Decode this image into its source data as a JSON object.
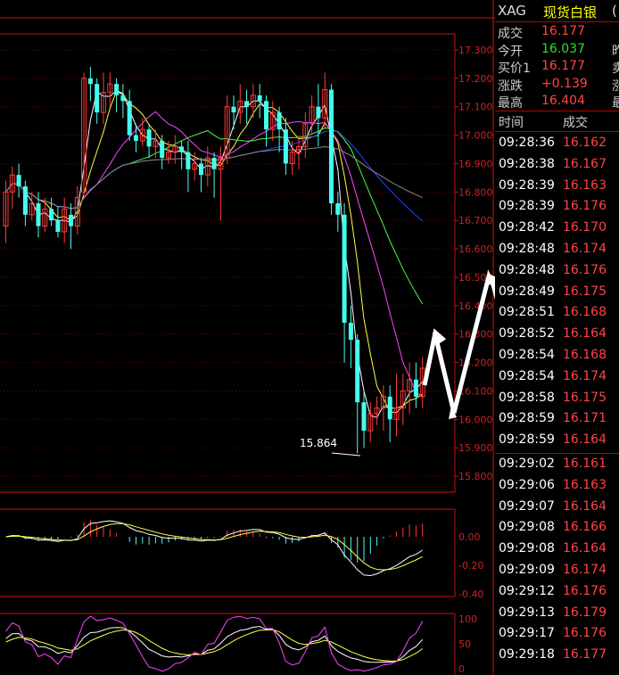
{
  "chart_data": {
    "type": "candlestick",
    "price_axis": {
      "ticks": [
        "17.300",
        "17.200",
        "17.100",
        "17.000",
        "16.900",
        "16.800",
        "16.700",
        "16.600",
        "16.500",
        "16.400",
        "16.300",
        "16.200",
        "16.100",
        "16.000",
        "15.900",
        "15.800"
      ],
      "min": 15.75,
      "max": 17.35
    },
    "low_label": "15.864",
    "candles": [
      [
        16.68,
        16.8,
        16.62,
        16.84
      ],
      [
        16.8,
        16.86,
        16.74,
        16.89
      ],
      [
        16.86,
        16.82,
        16.78,
        16.9
      ],
      [
        16.82,
        16.72,
        16.68,
        16.84
      ],
      [
        16.72,
        16.76,
        16.7,
        16.8
      ],
      [
        16.76,
        16.68,
        16.64,
        16.8
      ],
      [
        16.68,
        16.74,
        16.66,
        16.78
      ],
      [
        16.74,
        16.7,
        16.68,
        16.78
      ],
      [
        16.7,
        16.66,
        16.64,
        16.75
      ],
      [
        16.66,
        16.74,
        16.62,
        16.78
      ],
      [
        16.72,
        16.68,
        16.6,
        16.76
      ],
      [
        16.68,
        16.78,
        16.65,
        16.82
      ],
      [
        16.8,
        17.2,
        16.78,
        17.22
      ],
      [
        17.2,
        17.18,
        17.12,
        17.24
      ],
      [
        17.18,
        17.08,
        17.04,
        17.2
      ],
      [
        17.08,
        17.15,
        17.04,
        17.22
      ],
      [
        17.15,
        17.18,
        17.1,
        17.22
      ],
      [
        17.18,
        17.14,
        17.08,
        17.2
      ],
      [
        17.14,
        17.12,
        17.06,
        17.18
      ],
      [
        17.12,
        17.0,
        16.98,
        17.16
      ],
      [
        17.0,
        16.98,
        16.94,
        17.04
      ],
      [
        16.98,
        17.02,
        16.96,
        17.06
      ],
      [
        17.02,
        16.96,
        16.92,
        17.04
      ],
      [
        16.96,
        16.98,
        16.92,
        17.02
      ],
      [
        16.98,
        16.92,
        16.88,
        17.0
      ],
      [
        16.92,
        16.94,
        16.9,
        16.98
      ],
      [
        16.94,
        16.96,
        16.9,
        17.0
      ],
      [
        16.96,
        16.94,
        16.88,
        16.98
      ],
      [
        16.94,
        16.88,
        16.8,
        16.98
      ],
      [
        16.88,
        16.9,
        16.84,
        16.94
      ],
      [
        16.9,
        16.86,
        16.8,
        16.92
      ],
      [
        16.86,
        16.92,
        16.82,
        16.96
      ],
      [
        16.92,
        16.88,
        16.78,
        16.94
      ],
      [
        16.88,
        16.92,
        16.7,
        16.96
      ],
      [
        16.92,
        17.1,
        16.9,
        17.14
      ],
      [
        17.1,
        17.08,
        17.02,
        17.14
      ],
      [
        17.08,
        17.12,
        17.04,
        17.18
      ],
      [
        17.12,
        17.1,
        17.04,
        17.16
      ],
      [
        17.1,
        17.14,
        17.06,
        17.18
      ],
      [
        17.14,
        17.12,
        17.06,
        17.18
      ],
      [
        17.12,
        17.02,
        16.96,
        17.14
      ],
      [
        17.02,
        17.08,
        16.98,
        17.12
      ],
      [
        17.08,
        17.02,
        16.94,
        17.1
      ],
      [
        17.02,
        16.9,
        16.86,
        17.06
      ],
      [
        16.9,
        16.94,
        16.86,
        16.98
      ],
      [
        16.94,
        16.96,
        16.88,
        17.0
      ],
      [
        16.96,
        17.04,
        16.92,
        17.08
      ],
      [
        17.04,
        17.1,
        17.0,
        17.14
      ],
      [
        17.1,
        17.06,
        16.96,
        17.18
      ],
      [
        17.06,
        17.16,
        17.02,
        17.22
      ],
      [
        17.16,
        16.76,
        16.72,
        17.18
      ],
      [
        16.76,
        16.72,
        16.66,
        16.8
      ],
      [
        16.72,
        16.34,
        16.2,
        16.76
      ],
      [
        16.34,
        16.28,
        16.18,
        16.4
      ],
      [
        16.28,
        16.06,
        15.88,
        16.3
      ],
      [
        16.06,
        15.96,
        15.9,
        16.1
      ],
      [
        15.96,
        16.02,
        15.92,
        16.06
      ],
      [
        16.02,
        16.04,
        15.98,
        16.08
      ],
      [
        16.04,
        16.08,
        15.96,
        16.12
      ],
      [
        16.08,
        16.0,
        15.92,
        16.12
      ],
      [
        16.0,
        16.04,
        15.94,
        16.16
      ],
      [
        16.04,
        16.1,
        15.98,
        16.16
      ],
      [
        16.1,
        16.14,
        16.02,
        16.2
      ],
      [
        16.14,
        16.08,
        16.04,
        16.2
      ],
      [
        16.08,
        16.18,
        16.04,
        16.22
      ]
    ],
    "macd": {
      "ticks": [
        "0.00",
        "-0.20",
        "-0.40"
      ]
    },
    "kdj": {
      "ticks": [
        "100",
        "50",
        "0"
      ]
    }
  },
  "sidebar": {
    "header": {
      "code": "XAG",
      "name": "现货白银",
      "cut": "("
    },
    "quote": [
      {
        "label": "成交",
        "value": "16.177",
        "color": "#ff4444",
        "cut": ""
      },
      {
        "label": "今开",
        "value": "16.037",
        "color": "#33dd33",
        "cut": "昨"
      },
      {
        "label": "买价1",
        "value": "16.177",
        "color": "#ff4444",
        "cut": "卖"
      },
      {
        "label": "涨跌",
        "value": "+0.139",
        "color": "#ff4444",
        "cut": "涨"
      },
      {
        "label": "最高",
        "value": "16.404",
        "color": "#ff4444",
        "cut": "最"
      }
    ],
    "trades_header": {
      "time": "时间",
      "price": "成交"
    },
    "trades": [
      {
        "time": "09:28:36",
        "price": "16.162"
      },
      {
        "time": "09:28:38",
        "price": "16.167"
      },
      {
        "time": "09:28:39",
        "price": "16.163"
      },
      {
        "time": "09:28:39",
        "price": "16.176"
      },
      {
        "time": "09:28:42",
        "price": "16.170"
      },
      {
        "time": "09:28:48",
        "price": "16.174"
      },
      {
        "time": "09:28:48",
        "price": "16.176"
      },
      {
        "time": "09:28:49",
        "price": "16.175"
      },
      {
        "time": "09:28:51",
        "price": "16.168"
      },
      {
        "time": "09:28:52",
        "price": "16.164"
      },
      {
        "time": "09:28:54",
        "price": "16.168"
      },
      {
        "time": "09:28:54",
        "price": "16.174"
      },
      {
        "time": "09:28:58",
        "price": "16.175"
      },
      {
        "time": "09:28:59",
        "price": "16.171"
      },
      {
        "time": "09:28:59",
        "price": "16.164"
      },
      {
        "time": "09:29:02",
        "price": "16.161"
      },
      {
        "time": "09:29:06",
        "price": "16.163"
      },
      {
        "time": "09:29:07",
        "price": "16.164"
      },
      {
        "time": "09:29:08",
        "price": "16.166"
      },
      {
        "time": "09:29:08",
        "price": "16.164"
      },
      {
        "time": "09:29:09",
        "price": "16.174"
      },
      {
        "time": "09:29:12",
        "price": "16.176"
      },
      {
        "time": "09:29:13",
        "price": "16.179"
      },
      {
        "time": "09:29:17",
        "price": "16.176"
      },
      {
        "time": "09:29:18",
        "price": "16.177"
      }
    ]
  }
}
